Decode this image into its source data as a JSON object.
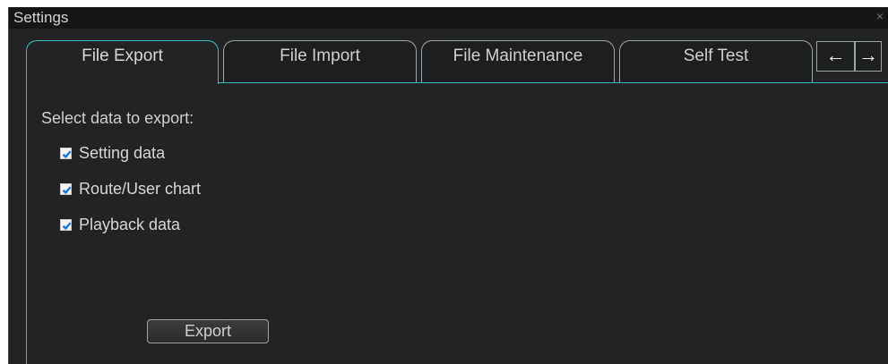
{
  "window": {
    "title": "Settings",
    "close_glyph": "×"
  },
  "tabs": [
    {
      "label": "File Export",
      "active": true
    },
    {
      "label": "File Import",
      "active": false
    },
    {
      "label": "File Maintenance",
      "active": false
    },
    {
      "label": "Self Test",
      "active": false
    }
  ],
  "tab_scroll": {
    "left_glyph": "←",
    "right_glyph": "→",
    "left_icon": "arrow-left-icon",
    "right_icon": "arrow-right-icon"
  },
  "export_panel": {
    "heading": "Select data to export:",
    "options": [
      {
        "label": "Setting data",
        "checked": true
      },
      {
        "label": "Route/User chart",
        "checked": true
      },
      {
        "label": "Playback data",
        "checked": true
      }
    ],
    "export_label": "Export"
  },
  "colors": {
    "accent": "#3eb8c0",
    "check": "#1a6fd8",
    "background": "#222325"
  }
}
